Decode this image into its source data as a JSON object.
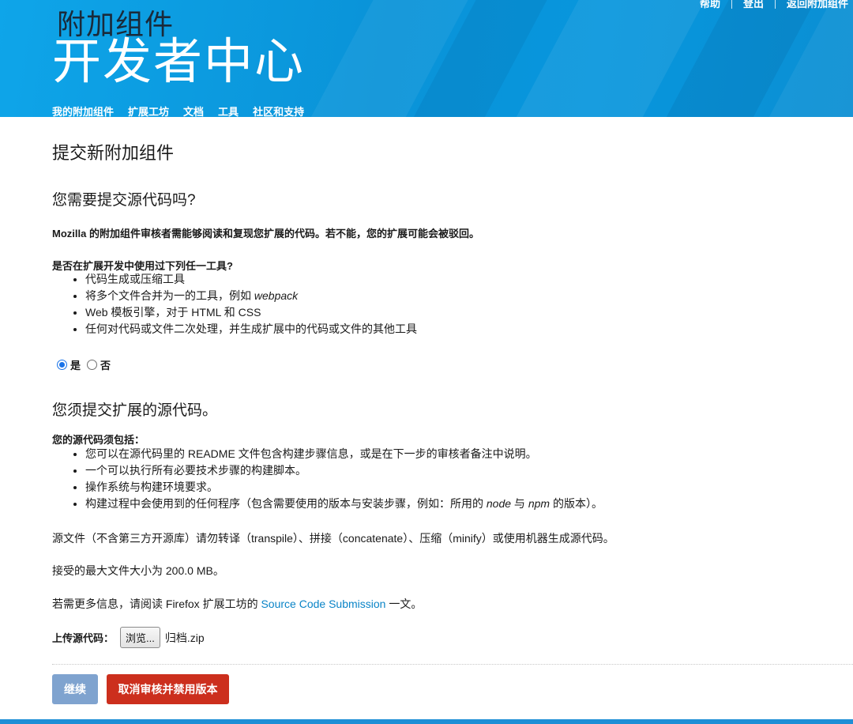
{
  "header": {
    "logo_top": "附加组件",
    "logo_main": "开发者中心",
    "top_links": [
      "帮助",
      "登出",
      "返回附加组件"
    ],
    "nav": [
      "我的附加组件",
      "扩展工坊",
      "文档",
      "工具",
      "社区和支持"
    ]
  },
  "page": {
    "title": "提交新附加组件",
    "section1": {
      "heading": "您需要提交源代码吗?",
      "intro": "Mozilla 的附加组件审核者需能够阅读和复现您扩展的代码。若不能，您的扩展可能会被驳回。",
      "question": "是否在扩展开发中使用过下列任一工具?",
      "tools": [
        {
          "text": "代码生成或压缩工具",
          "em": "",
          "after": ""
        },
        {
          "text": "将多个文件合并为一的工具，例如 ",
          "em": "webpack",
          "after": ""
        },
        {
          "text": "Web 模板引擎，对于 HTML 和 CSS",
          "em": "",
          "after": ""
        },
        {
          "text": "任何对代码或文件二次处理，并生成扩展中的代码或文件的其他工具",
          "em": "",
          "after": ""
        }
      ],
      "radio_yes": "是",
      "radio_no": "否",
      "selected": "是"
    },
    "section2": {
      "heading": "您须提交扩展的源代码。",
      "must_include": "您的源代码须包括：",
      "items": [
        {
          "text": "您可以在源代码里的 README 文件包含构建步骤信息，或是在下一步的审核者备注中说明。"
        },
        {
          "text": "一个可以执行所有必要技术步骤的构建脚本。"
        },
        {
          "text": "操作系统与构建环境要求。"
        },
        {
          "pre": "构建过程中会使用到的任何程序（包含需要使用的版本与安装步骤，例如：所用的 ",
          "em1": "node",
          "mid": " 与 ",
          "em2": "npm",
          "post": " 的版本）。"
        }
      ],
      "no_transpile": "源文件（不含第三方开源库）请勿转译（transpile）、拼接（concatenate）、压缩（minify）或使用机器生成源代码。",
      "max_size": "接受的最大文件大小为 200.0 MB。",
      "more_info_pre": "若需更多信息，请阅读 Firefox 扩展工坊的 ",
      "more_info_link": "Source Code Submission",
      "more_info_post": " 一文。",
      "upload_label": "上传源代码：",
      "browse_label": "浏览...",
      "file_name": "归档.zip"
    },
    "buttons": {
      "continue": "继续",
      "cancel": "取消审核并禁用版本"
    }
  },
  "colors": {
    "header_blue": "#0a93d8",
    "link": "#0a84c7",
    "continue_button": "#7fa3cf",
    "cancel_button": "#cc2f1d",
    "radio_checked": "#1a73e8"
  }
}
